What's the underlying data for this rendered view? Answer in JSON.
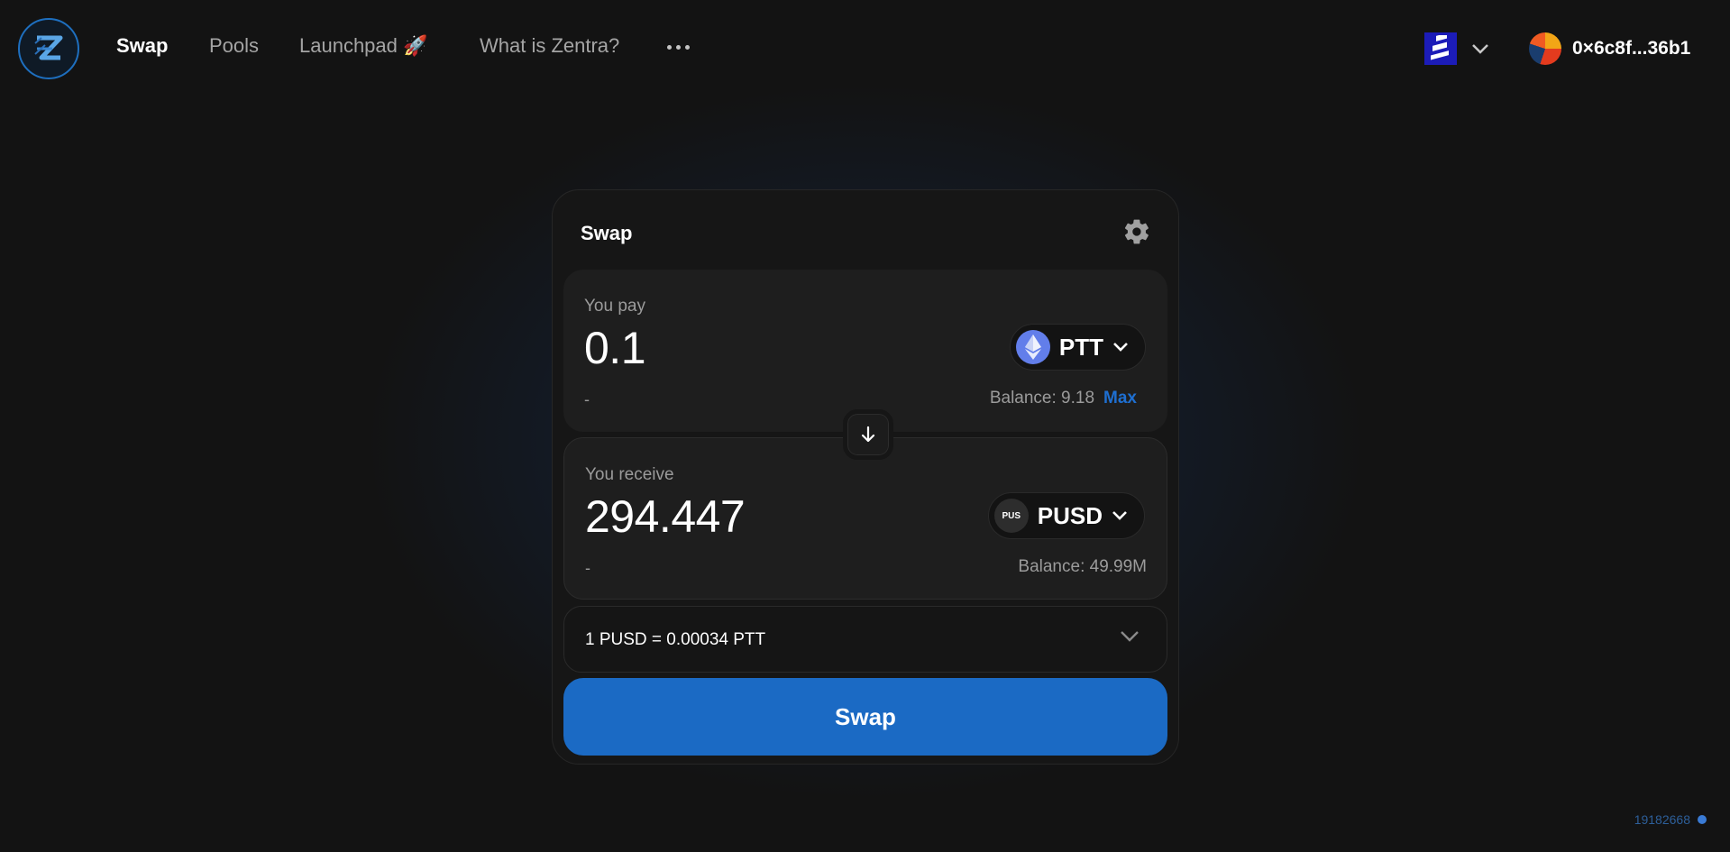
{
  "nav": {
    "items": [
      {
        "label": "Swap",
        "active": true
      },
      {
        "label": "Pools",
        "active": false
      },
      {
        "label": "Launchpad 🚀",
        "active": false
      },
      {
        "label": "What is Zentra?",
        "active": false
      }
    ],
    "more_icon": "more-dots-icon"
  },
  "header": {
    "chain_icon": "chain-logo-icon",
    "account_address": "0×6c8f...36b1"
  },
  "swap_card": {
    "title": "Swap",
    "settings_icon": "gear-icon",
    "pay": {
      "label": "You pay",
      "amount": "0.1",
      "usd_value": "-",
      "token": "PTT",
      "token_icon": "ethereum-icon",
      "balance": "Balance: 9.18",
      "max_label": "Max"
    },
    "receive": {
      "label": "You receive",
      "amount": "294.447",
      "usd_value": "-",
      "token": "PUSD",
      "token_icon_text": "PUS",
      "balance": "Balance: 49.99M"
    },
    "rate": "1 PUSD = 0.00034 PTT",
    "submit_label": "Swap"
  },
  "footer": {
    "block_number": "19182668"
  },
  "colors": {
    "accent": "#1b6ac4",
    "background": "#131313",
    "card": "#161616",
    "panel": "#1e1e1e"
  }
}
